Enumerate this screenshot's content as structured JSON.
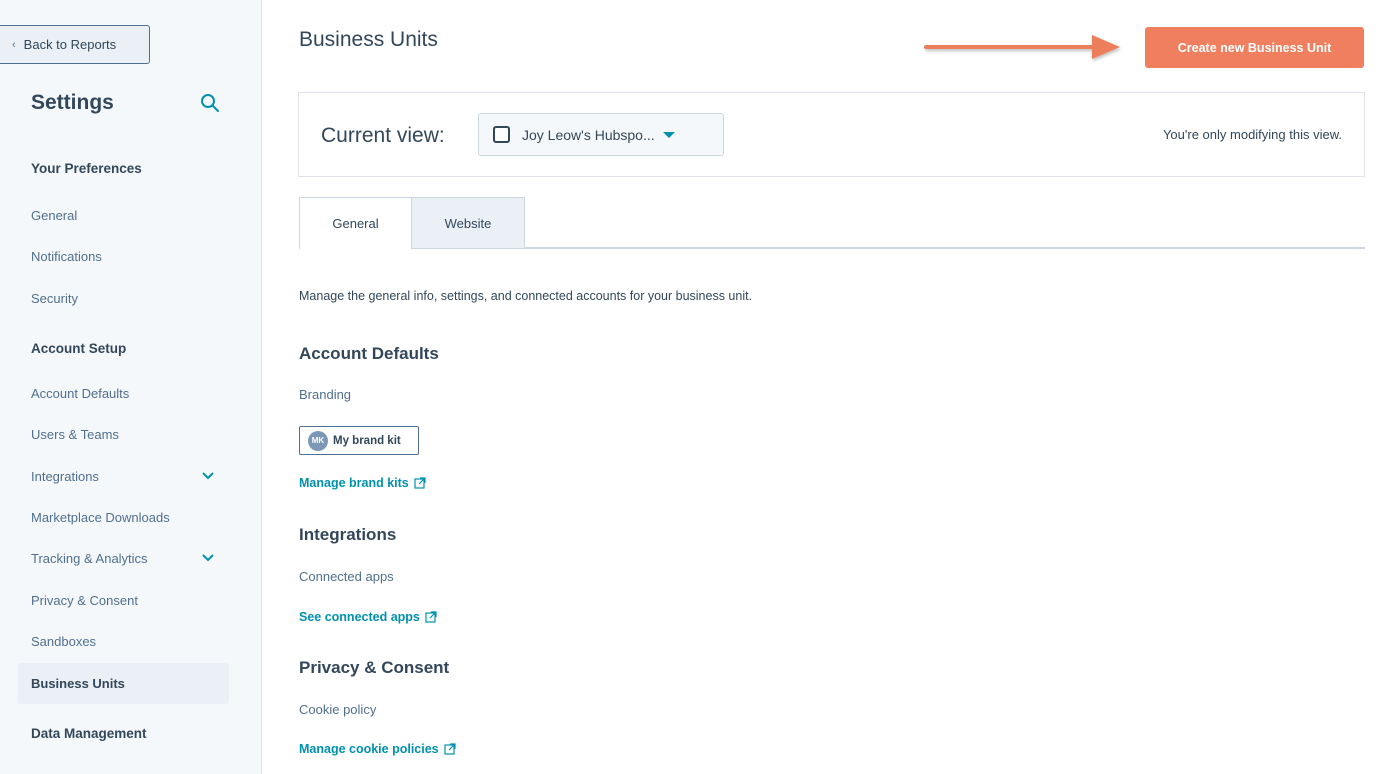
{
  "sidebar": {
    "back_label": "Back to Reports",
    "title": "Settings",
    "items": [
      {
        "label": "Your Preferences",
        "type": "section"
      },
      {
        "label": "General",
        "type": "item"
      },
      {
        "label": "Notifications",
        "type": "item"
      },
      {
        "label": "Security",
        "type": "item"
      },
      {
        "label": "Account Setup",
        "type": "section"
      },
      {
        "label": "Account Defaults",
        "type": "item"
      },
      {
        "label": "Users & Teams",
        "type": "item"
      },
      {
        "label": "Integrations",
        "type": "item",
        "expandable": true
      },
      {
        "label": "Marketplace Downloads",
        "type": "item"
      },
      {
        "label": "Tracking & Analytics",
        "type": "item",
        "expandable": true
      },
      {
        "label": "Privacy & Consent",
        "type": "item"
      },
      {
        "label": "Sandboxes",
        "type": "item"
      },
      {
        "label": "Business Units",
        "type": "item",
        "active": true
      },
      {
        "label": "Data Management",
        "type": "section"
      }
    ]
  },
  "main": {
    "title": "Business Units",
    "create_button": "Create new Business Unit",
    "current_view": {
      "label": "Current view:",
      "selected": "Joy Leow's Hubspo...",
      "note": "You're only modifying this view."
    },
    "tabs": [
      "General",
      "Website"
    ],
    "intro": "Manage the general info, settings, and connected accounts for your business unit.",
    "account_defaults": {
      "heading": "Account Defaults",
      "sub_label": "Branding",
      "brand_kit_initials": "MK",
      "brand_kit_label": "My brand kit",
      "link": "Manage brand kits"
    },
    "integrations": {
      "heading": "Integrations",
      "sub_label": "Connected apps",
      "link": "See connected apps"
    },
    "privacy": {
      "heading": "Privacy & Consent",
      "sub_label": "Cookie policy",
      "link": "Manage cookie policies"
    }
  },
  "colors": {
    "accent": "#f07f5f",
    "link": "#0091ae",
    "text": "#33475b",
    "sidebar_bg": "#f5f8fa"
  }
}
